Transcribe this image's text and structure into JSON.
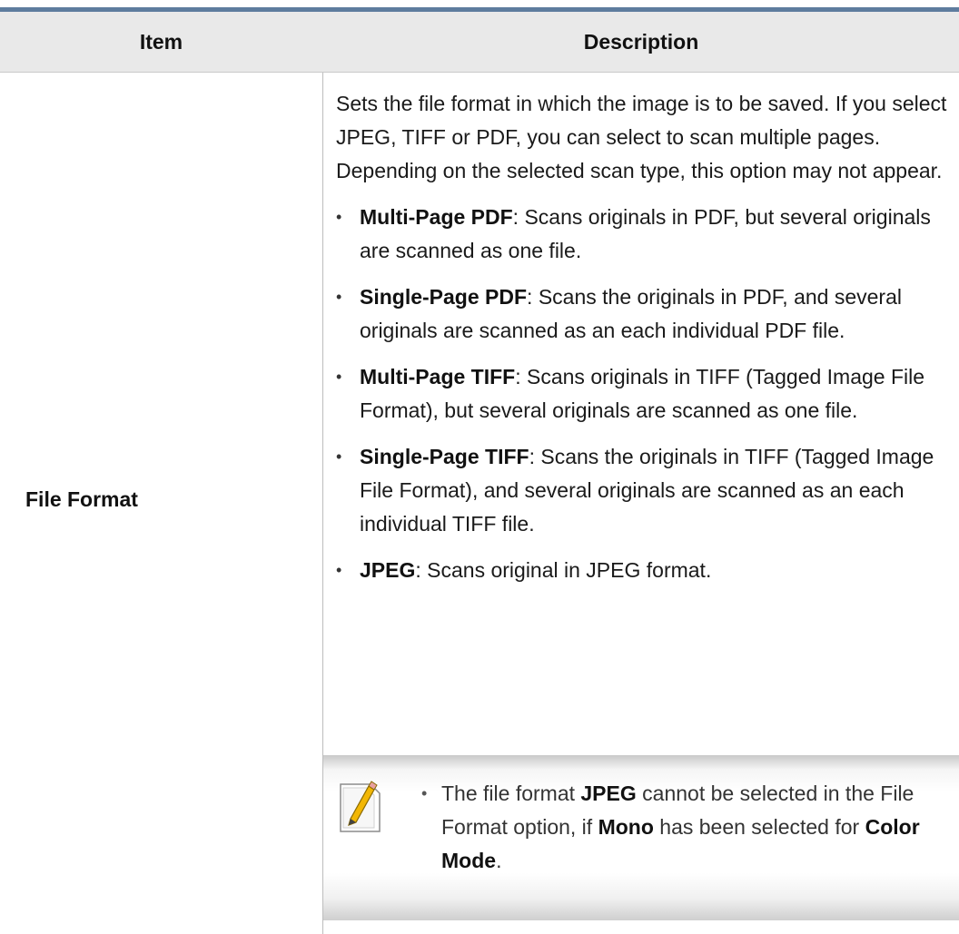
{
  "table": {
    "headers": {
      "item": "Item",
      "description": "Description"
    },
    "rows": [
      {
        "item": "File Format",
        "intro": "Sets the file format in which the image is to be saved. If you select JPEG, TIFF or PDF, you can select to scan multiple pages. Depending on the selected scan type, this option may not appear.",
        "options": [
          {
            "term": "Multi-Page PDF",
            "text": ": Scans originals in PDF, but several originals are scanned as one file."
          },
          {
            "term": "Single-Page PDF",
            "text": ": Scans the originals in PDF, and several originals are scanned as an each individual PDF file."
          },
          {
            "term": "Multi-Page TIFF",
            "text": ": Scans originals in TIFF (Tagged Image File Format), but several originals are scanned as one file."
          },
          {
            "term": "Single-Page TIFF",
            "text": ": Scans the originals in TIFF (Tagged Image File Format), and several originals are scanned as an each individual TIFF file."
          },
          {
            "term": "JPEG",
            "text": ": Scans original in JPEG format."
          }
        ],
        "note": {
          "icon": "note-pencil-icon",
          "t1": "The file format ",
          "b1": "JPEG",
          "t2": " cannot be selected in the File Format option, if ",
          "b2": "Mono",
          "t3": " has been selected for ",
          "b3": "Color Mode",
          "t4": "."
        }
      }
    ]
  },
  "colors": {
    "header_rule": "#5e7c9e",
    "header_bg": "#e9e9e9",
    "note_pencil": "#f2b705"
  }
}
